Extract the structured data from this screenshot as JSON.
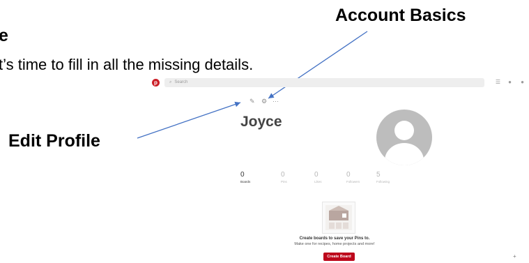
{
  "slide": {
    "title_fragment": "e",
    "subtitle_fragment": "t’s time to fill in all the missing details."
  },
  "callouts": {
    "account_basics": "Account Basics",
    "edit_profile": "Edit Profile"
  },
  "app": {
    "brand_color": "#bd081c",
    "logo_letter": "p",
    "search_placeholder": "Search",
    "top_icons": [
      "menu-icon",
      "person-icon",
      "chat-icon"
    ]
  },
  "profile": {
    "name": "Joyce",
    "toolbar_icons": [
      "pencil-icon",
      "gear-icon",
      "more-icon"
    ],
    "more_glyph": "···",
    "stats": [
      {
        "value": "0",
        "label": "Boards",
        "active": true
      },
      {
        "value": "0",
        "label": "Pins",
        "active": false
      },
      {
        "value": "0",
        "label": "Likes",
        "active": false
      },
      {
        "value": "0",
        "label": "Followers",
        "active": false
      },
      {
        "value": "5",
        "label": "Following",
        "active": false
      }
    ]
  },
  "empty_state": {
    "title": "Create boards to save your Pins to.",
    "subtitle": "Make one for recipes, home projects and more!",
    "button_label": "Create Board"
  },
  "corner": {
    "plus_glyph": "+"
  }
}
